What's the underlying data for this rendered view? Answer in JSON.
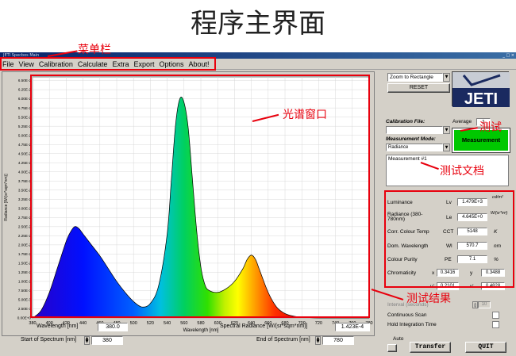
{
  "slide": {
    "title": "程序主界面"
  },
  "annotations": {
    "menu_bar": "菜单栏",
    "spectrum_window": "光谱窗口",
    "test": "测试",
    "test_doc": "测试文档",
    "results": "测试结果"
  },
  "window": {
    "title": "JETI Specbos Main",
    "controls": "_ □ ×"
  },
  "menu": [
    "File",
    "View",
    "Calibration",
    "Calculate",
    "Extra",
    "Export",
    "Options",
    "About!"
  ],
  "chart_data": {
    "type": "line",
    "xlabel": "Wavelength [nm]",
    "ylabel": "Radiance [W/(sr*sqm*nm)]",
    "xlim": [
      380,
      780
    ],
    "ylim": [
      0,
      0.0066
    ],
    "x_ticks": [
      "380",
      "400",
      "420",
      "440",
      "460",
      "480",
      "500",
      "520",
      "540",
      "560",
      "580",
      "600",
      "620",
      "640",
      "660",
      "680",
      "700",
      "720",
      "740",
      "760",
      "780"
    ],
    "y_ticks": [
      "0.00E+0",
      "2.50E-3",
      "5.00E-3",
      "7.50E-3",
      "1.00E-2",
      "1.25E-2",
      "1.50E-2",
      "1.75E-2",
      "2.00E-2",
      "2.25E-2",
      "2.50E-2",
      "2.75E-2",
      "3.00E-2",
      "3.25E-2",
      "3.50E-2",
      "3.75E-2",
      "4.00E-2",
      "4.25E-2",
      "4.50E-2",
      "4.75E-2",
      "5.00E-2",
      "5.25E-2",
      "5.50E-2",
      "5.75E-2",
      "6.00E-2",
      "6.25E-2",
      "6.50E-2"
    ],
    "grid": true,
    "series": [
      {
        "x": [
          380,
          390,
          400,
          410,
          420,
          425,
          430,
          435,
          440,
          450,
          460,
          470,
          480,
          490,
          500,
          510,
          520,
          530,
          540,
          545,
          550,
          555,
          560,
          565,
          570,
          575,
          580,
          585,
          590,
          600,
          610,
          620,
          630,
          635,
          640,
          645,
          650,
          660,
          670,
          680,
          690,
          700,
          720,
          740,
          760,
          780
        ],
        "y": [
          0.0,
          0.0002,
          0.0007,
          0.0014,
          0.0021,
          0.00235,
          0.0025,
          0.00245,
          0.0023,
          0.002,
          0.0017,
          0.00135,
          0.001,
          0.0007,
          0.00045,
          0.0003,
          0.0004,
          0.0009,
          0.0023,
          0.0038,
          0.0053,
          0.006,
          0.0059,
          0.0052,
          0.0038,
          0.0024,
          0.0014,
          0.0009,
          0.00075,
          0.0007,
          0.0008,
          0.001,
          0.00135,
          0.0016,
          0.00172,
          0.0016,
          0.0013,
          0.0007,
          0.0003,
          0.00012,
          5e-05,
          2e-05,
          0.0,
          0.0,
          0.0,
          0.0
        ]
      }
    ]
  },
  "bottom": {
    "wavelength_label": "Wavelength [nm]",
    "wavelength_value": "380.0",
    "spectral_label": "Spectral Radiance [W/(sr*sqm*nm)]",
    "spectral_value": "1.423E-4",
    "start_label": "Start of Spectrum [nm]",
    "start_value": "380",
    "end_label": "End of Spectrum [nm]",
    "end_value": "780"
  },
  "right": {
    "zoom_select": "Zoom to Rectangle",
    "reset": "RESET",
    "logo": "JETI",
    "calibration_label": "Calibration File:",
    "average_label": "Average",
    "average_value": "1",
    "measurement_mode_label": "Measurement Mode:",
    "measurement_mode_value": "Radiance",
    "measurement_button": "Measurement",
    "doc_text": "Measurement #1",
    "results": [
      {
        "name": "Luminance",
        "sym": "Lv",
        "value": "1.479E+3",
        "unit": "cd/m²"
      },
      {
        "name": "Radiance (380-780nm)",
        "sym": "Le",
        "value": "4.645E+0",
        "unit": "W/(sr*m²)"
      },
      {
        "name": "Corr. Colour Temp",
        "sym": "CCT",
        "value": "5148",
        "unit": "K"
      },
      {
        "name": "Dom. Wavelength",
        "sym": "Wl",
        "value": "570.7",
        "unit": "nm"
      },
      {
        "name": "Colour Purity",
        "sym": "PE",
        "value": "7.1",
        "unit": "%"
      }
    ],
    "chromaticity_label": "Chromaticity",
    "chroma_x_label": "x",
    "chroma_x": "0.3416",
    "chroma_y_label": "y",
    "chroma_y": "0.3488",
    "chroma_u_label": "u'",
    "chroma_u": "0.2101",
    "chroma_v_label": "v'",
    "chroma_v": "0.4828",
    "interval_label": "Interval (seconds)",
    "interval_value": "10",
    "continuous_label": "Continuous Scan",
    "hold_label": "Hold Integration Time",
    "auto_label": "Auto",
    "transfer": "Transfer",
    "quit": "QUIT"
  }
}
